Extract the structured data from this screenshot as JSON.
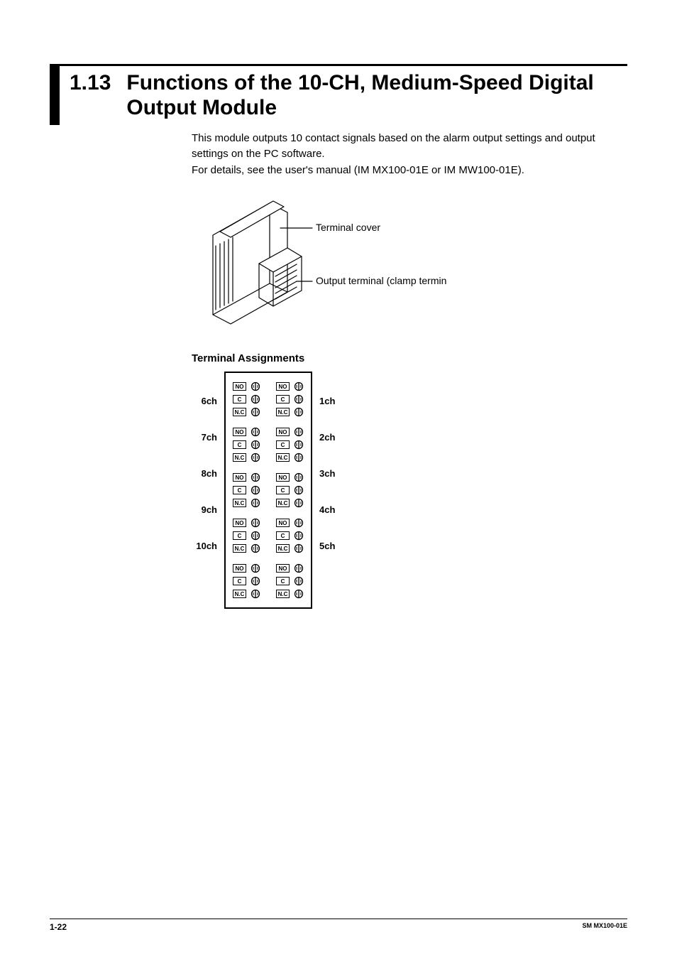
{
  "heading": {
    "number": "1.13",
    "title_line1": "Functions of the 10-CH, Medium-Speed Digital",
    "title_line2": "Output Module"
  },
  "body": {
    "para1": "This module outputs 10 contact signals based on the alarm output settings and output settings on the PC software.",
    "para2": "For details, see the user's manual (IM MX100-01E or IM MW100-01E)."
  },
  "illustration": {
    "callout1": "Terminal cover",
    "callout2": "Output terminal (clamp terminal)"
  },
  "subheading": "Terminal Assignments",
  "terminal": {
    "contact_labels": [
      "NO",
      "C",
      "N.C"
    ],
    "left_channels": [
      "6ch",
      "7ch",
      "8ch",
      "9ch",
      "10ch"
    ],
    "right_channels": [
      "1ch",
      "2ch",
      "3ch",
      "4ch",
      "5ch"
    ]
  },
  "footer": {
    "page": "1-22",
    "doc": "SM MX100-01E"
  }
}
